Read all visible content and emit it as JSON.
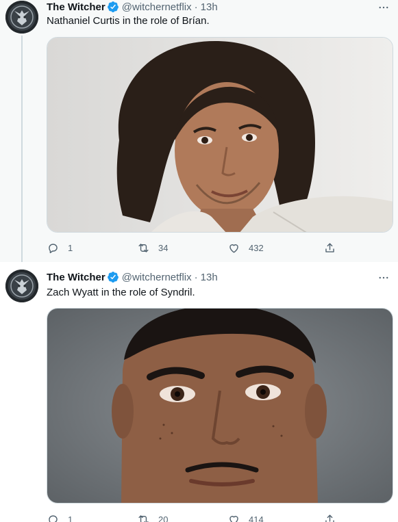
{
  "tweets": [
    {
      "author_name": "The Witcher",
      "handle": "@witchernetflix",
      "separator": "·",
      "time": "13h",
      "text": "Nathaniel Curtis in the role of Brían.",
      "media_icon": "portrait-photo",
      "replies": "1",
      "retweets": "34",
      "likes": "432"
    },
    {
      "author_name": "The Witcher",
      "handle": "@witchernetflix",
      "separator": "·",
      "time": "13h",
      "text": "Zach Wyatt in the role of Syndril.",
      "media_icon": "portrait-photo",
      "replies": "1",
      "retweets": "20",
      "likes": "414"
    }
  ],
  "colors": {
    "verified": "#1d9bf0",
    "secondary_text": "#536471",
    "hover_background": "#f7f9f9",
    "divider": "#cfd9de"
  }
}
